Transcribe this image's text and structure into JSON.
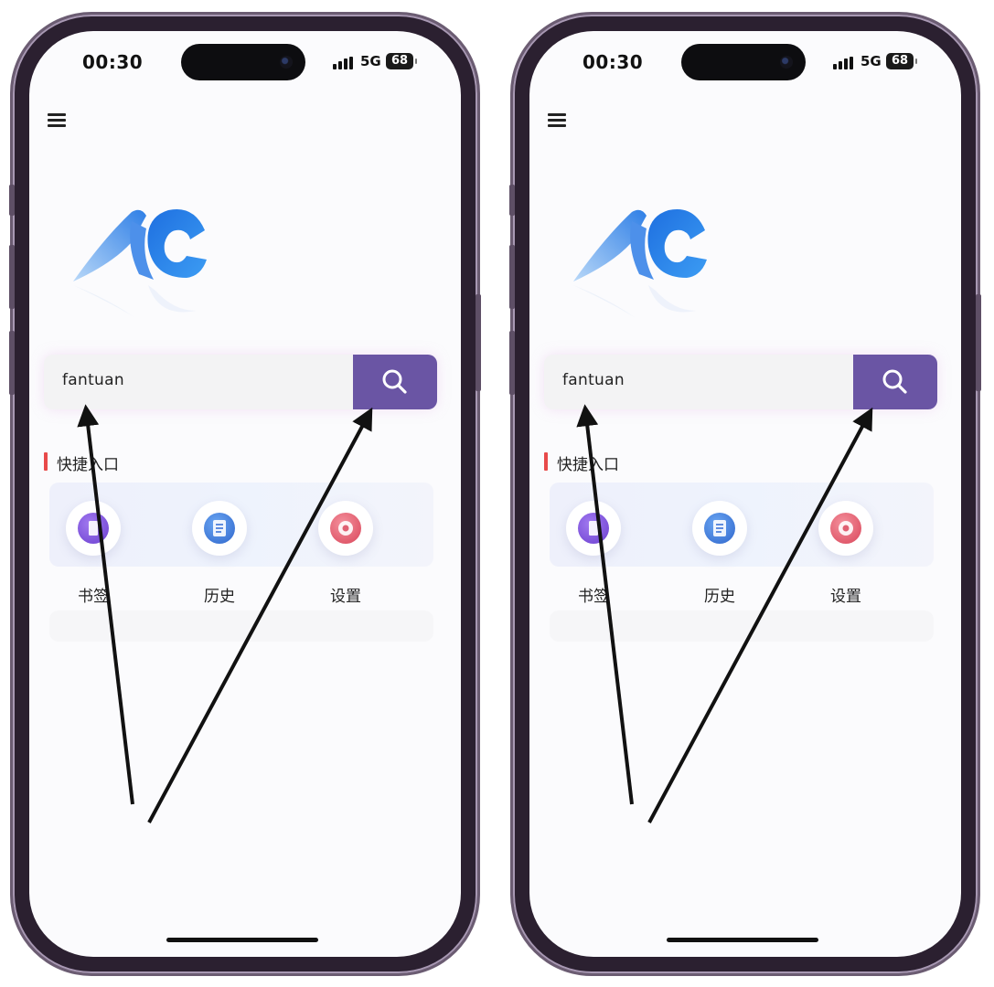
{
  "screens": [
    {
      "status_bar": {
        "time": "00:30",
        "network": "5G",
        "battery": "68"
      },
      "search": {
        "value": "fantuan"
      },
      "section": {
        "title": "快捷入口"
      },
      "quick_items": [
        {
          "label": "书签",
          "icon": "bookmark-icon"
        },
        {
          "label": "历史",
          "icon": "history-icon"
        },
        {
          "label": "设置",
          "icon": "settings-icon"
        }
      ]
    },
    {
      "status_bar": {
        "time": "00:30",
        "network": "5G",
        "battery": "68"
      },
      "search": {
        "value": "fantuan"
      },
      "section": {
        "title": "快捷入口"
      },
      "quick_items": [
        {
          "label": "书签",
          "icon": "bookmark-icon"
        },
        {
          "label": "历史",
          "icon": "history-icon"
        },
        {
          "label": "设置",
          "icon": "settings-icon"
        }
      ]
    }
  ],
  "colors": {
    "search_button": "#6a55a4",
    "section_bar": "#e84a4a",
    "bookmark": "#7b4fd6",
    "history": "#3a78d8",
    "settings": "#e65a6e"
  }
}
